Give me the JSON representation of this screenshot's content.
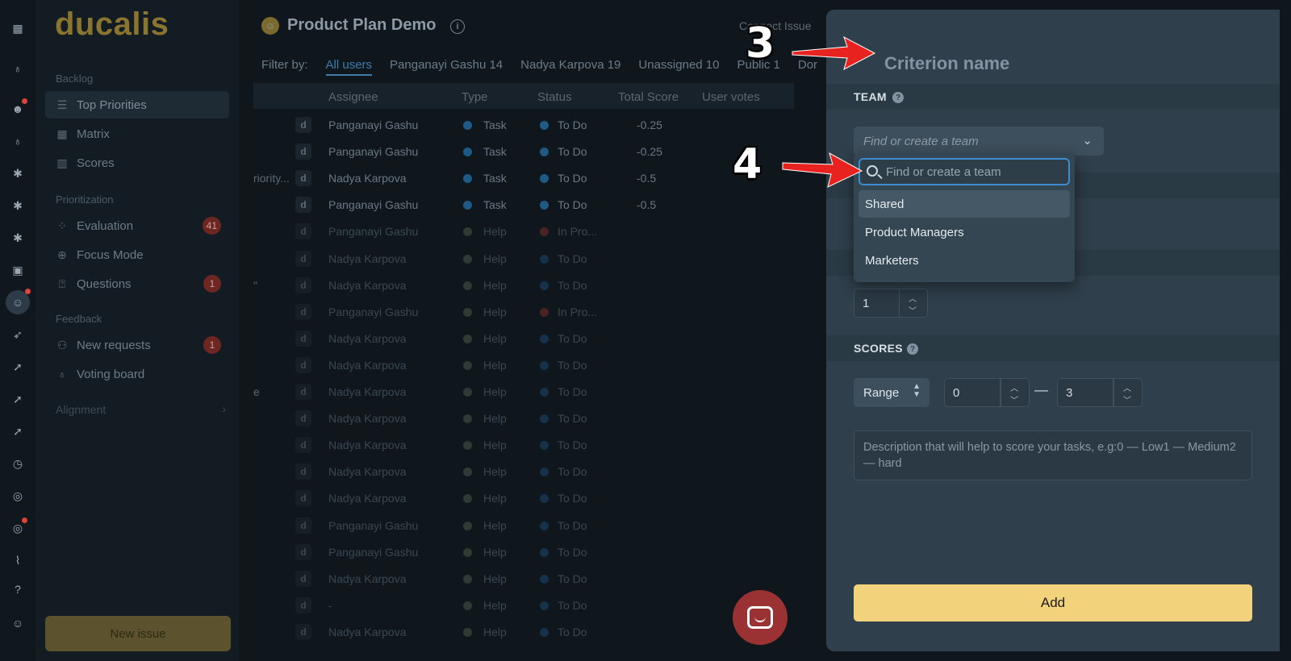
{
  "app": {
    "logo": "ducalis"
  },
  "rail": {
    "icons": [
      "grid-icon",
      "bulb-icon",
      "emoji-face-icon",
      "bulb-icon",
      "monster-icon",
      "monster-icon",
      "monster-icon",
      "calendar-icon",
      "nerd-face-icon",
      "runner-icon",
      "rocket-icon",
      "rocket-icon",
      "rocket-icon",
      "clock-icon",
      "target-icon",
      "target-icon",
      "chart-icon",
      "help-icon",
      "avatar-icon"
    ]
  },
  "sidebar": {
    "sections": {
      "backlog": "Backlog",
      "prioritization": "Prioritization",
      "feedback": "Feedback",
      "alignment": "Alignment"
    },
    "items": [
      {
        "label": "Top Priorities",
        "icon": "list-icon"
      },
      {
        "label": "Matrix",
        "icon": "matrix-icon"
      },
      {
        "label": "Scores",
        "icon": "columns-icon"
      },
      {
        "label": "Evaluation",
        "icon": "nodes-icon",
        "badge": "41"
      },
      {
        "label": "Focus Mode",
        "icon": "crosshair-icon"
      },
      {
        "label": "Questions",
        "icon": "question-board-icon",
        "badge": "1"
      },
      {
        "label": "New requests",
        "icon": "people-icon",
        "badge": "1"
      },
      {
        "label": "Voting board",
        "icon": "bulb-icon"
      }
    ],
    "new_issue": "New issue"
  },
  "main": {
    "title": "Product Plan Demo",
    "connect": "Connect Issue",
    "filter_label": "Filter by:",
    "filters": [
      "All users",
      "Panganayi Gashu 14",
      "Nadya Karpova 19",
      "Unassigned 10",
      "Public 1",
      "Dor"
    ],
    "columns": [
      "Assignee",
      "Type",
      "Status",
      "Total Score",
      "User votes"
    ],
    "rows": [
      {
        "prefix": "",
        "initial": "d",
        "assignee": "Panganayi Gashu",
        "type": "Task",
        "status": "To Do",
        "score": "-0.25",
        "dim": false,
        "status_color": "#1e5a85",
        "type_color": "#1e5a85"
      },
      {
        "prefix": "",
        "initial": "d",
        "assignee": "Panganayi Gashu",
        "type": "Task",
        "status": "To Do",
        "score": "-0.25",
        "dim": false,
        "status_color": "#1e5a85",
        "type_color": "#1e5a85"
      },
      {
        "prefix": "riority...",
        "initial": "d",
        "assignee": "Nadya Karpova",
        "type": "Task",
        "status": "To Do",
        "score": "-0.5",
        "dim": false,
        "status_color": "#1e5a85",
        "type_color": "#1e5a85"
      },
      {
        "prefix": "",
        "initial": "d",
        "assignee": "Panganayi Gashu",
        "type": "Task",
        "status": "To Do",
        "score": "-0.5",
        "dim": false,
        "status_color": "#1e5a85",
        "type_color": "#1e5a85"
      },
      {
        "prefix": "",
        "initial": "d",
        "assignee": "Panganayi Gashu",
        "type": "Help",
        "status": "In Pro...",
        "score": "",
        "dim": true,
        "status_color": "#4a2422",
        "type_color": "#2e3a33"
      },
      {
        "prefix": "",
        "initial": "d",
        "assignee": "Nadya Karpova",
        "type": "Help",
        "status": "To Do",
        "score": "",
        "dim": true,
        "status_color": "#15324a",
        "type_color": "#2e3a33"
      },
      {
        "prefix": "\"",
        "initial": "d",
        "assignee": "Nadya Karpova",
        "type": "Help",
        "status": "To Do",
        "score": "",
        "dim": true,
        "status_color": "#15324a",
        "type_color": "#2e3a33"
      },
      {
        "prefix": "",
        "initial": "d",
        "assignee": "Panganayi Gashu",
        "type": "Help",
        "status": "In Pro...",
        "score": "",
        "dim": true,
        "status_color": "#4a2422",
        "type_color": "#2e3a33"
      },
      {
        "prefix": "",
        "initial": "d",
        "assignee": "Nadya Karpova",
        "type": "Help",
        "status": "To Do",
        "score": "",
        "dim": true,
        "status_color": "#15324a",
        "type_color": "#2e3a33"
      },
      {
        "prefix": "",
        "initial": "d",
        "assignee": "Nadya Karpova",
        "type": "Help",
        "status": "To Do",
        "score": "",
        "dim": true,
        "status_color": "#15324a",
        "type_color": "#2e3a33"
      },
      {
        "prefix": "e",
        "initial": "d",
        "assignee": "Nadya Karpova",
        "type": "Help",
        "status": "To Do",
        "score": "",
        "dim": true,
        "status_color": "#15324a",
        "type_color": "#2e3a33"
      },
      {
        "prefix": "",
        "initial": "d",
        "assignee": "Nadya Karpova",
        "type": "Help",
        "status": "To Do",
        "score": "",
        "dim": true,
        "status_color": "#15324a",
        "type_color": "#2e3a33"
      },
      {
        "prefix": "",
        "initial": "d",
        "assignee": "Nadya Karpova",
        "type": "Help",
        "status": "To Do",
        "score": "",
        "dim": true,
        "status_color": "#15324a",
        "type_color": "#2e3a33"
      },
      {
        "prefix": "",
        "initial": "d",
        "assignee": "Nadya Karpova",
        "type": "Help",
        "status": "To Do",
        "score": "",
        "dim": true,
        "status_color": "#15324a",
        "type_color": "#2e3a33"
      },
      {
        "prefix": "",
        "initial": "d",
        "assignee": "Nadya Karpova",
        "type": "Help",
        "status": "To Do",
        "score": "",
        "dim": true,
        "status_color": "#15324a",
        "type_color": "#2e3a33"
      },
      {
        "prefix": "",
        "initial": "d",
        "assignee": "Panganayi Gashu",
        "type": "Help",
        "status": "To Do",
        "score": "",
        "dim": true,
        "status_color": "#15324a",
        "type_color": "#2e3a33"
      },
      {
        "prefix": "",
        "initial": "d",
        "assignee": "Panganayi Gashu",
        "type": "Help",
        "status": "To Do",
        "score": "",
        "dim": true,
        "status_color": "#15324a",
        "type_color": "#2e3a33"
      },
      {
        "prefix": "",
        "initial": "d",
        "assignee": "Nadya Karpova",
        "type": "Help",
        "status": "To Do",
        "score": "",
        "dim": true,
        "status_color": "#15324a",
        "type_color": "#2e3a33"
      },
      {
        "prefix": "",
        "initial": "d",
        "assignee": "-",
        "type": "Help",
        "status": "To Do",
        "score": "",
        "dim": true,
        "status_color": "#15324a",
        "type_color": "#2e3a33"
      },
      {
        "prefix": "",
        "initial": "d",
        "assignee": "Nadya Karpova",
        "type": "Help",
        "status": "To Do",
        "score": "",
        "dim": true,
        "status_color": "#15324a",
        "type_color": "#2e3a33"
      }
    ]
  },
  "panel": {
    "criterion_placeholder": "Criterion name",
    "team_label": "TEAM",
    "team_placeholder": "Find or create a team",
    "dropdown": {
      "search_placeholder": "Find or create a team",
      "options": [
        "Shared",
        "Product Managers",
        "Marketers"
      ],
      "highlighted": "Shared"
    },
    "weight_value": "1",
    "scores_label": "SCORES",
    "scores_mode": "Range",
    "range_min": "0",
    "range_sep": "—",
    "range_max": "3",
    "description_placeholder": "Description that will help to score your tasks, e.g:0 — Low1 — Medium2 — hard",
    "add_label": "Add"
  },
  "annotations": {
    "step3": "3",
    "step4": "4",
    "arrow_color": "#e8231f"
  }
}
